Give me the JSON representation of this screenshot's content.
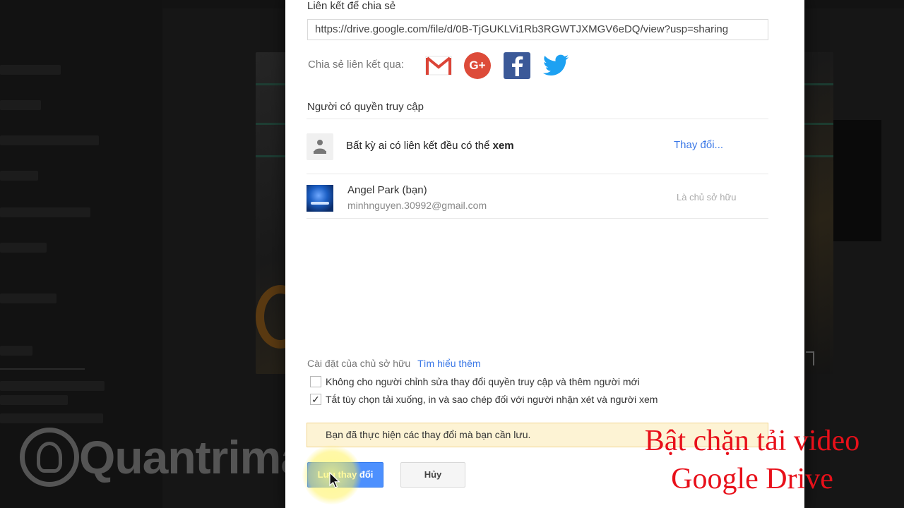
{
  "dialog": {
    "link_section_title": "Liên kết để chia sẻ",
    "share_link_value": "https://drive.google.com/file/d/0B-TjGUKLVi1Rb3RGWTJXMGV6eDQ/view?usp=sharing",
    "share_via_label": "Chia sẻ liên kết qua:",
    "social_icons": [
      "gmail-icon",
      "google-plus-icon",
      "facebook-icon",
      "twitter-icon"
    ],
    "gplus_glyph": "G+",
    "access_section_title": "Người có quyền truy cập",
    "access": {
      "text_prefix": "Bất kỳ ai có liên kết đều có thể",
      "text_emphasis": "xem",
      "change_label": "Thay đổi..."
    },
    "owner": {
      "name": "Angel Park (bạn)",
      "email": "minhnguyen.30992@gmail.com",
      "role": "Là chủ sở hữu"
    },
    "owner_settings": {
      "label": "Cài đặt của chủ sở hữu",
      "learn_more": "Tìm hiểu thêm"
    },
    "options": [
      {
        "label": "Không cho người chỉnh sửa thay đổi quyền truy cập và thêm người mới",
        "checked": false
      },
      {
        "label": "Tắt tùy chọn tải xuống, in và sao chép đối với người nhận xét và người xem",
        "checked": true
      }
    ],
    "check_glyph": "✓",
    "notice": "Bạn đã thực hiện các thay đổi mà bạn cần lưu.",
    "save_label": "Lưu thay đổi",
    "cancel_label": "Hủy"
  },
  "watermark": {
    "text": "Quantrimang"
  },
  "caption": {
    "line1": "Bật chặn tải video",
    "line2": "Google Drive"
  },
  "colors": {
    "accent_blue": "#4d90fe",
    "link_blue": "#3b78e7",
    "notice_bg": "#fdf3d4",
    "caption_red": "#e8101a"
  }
}
